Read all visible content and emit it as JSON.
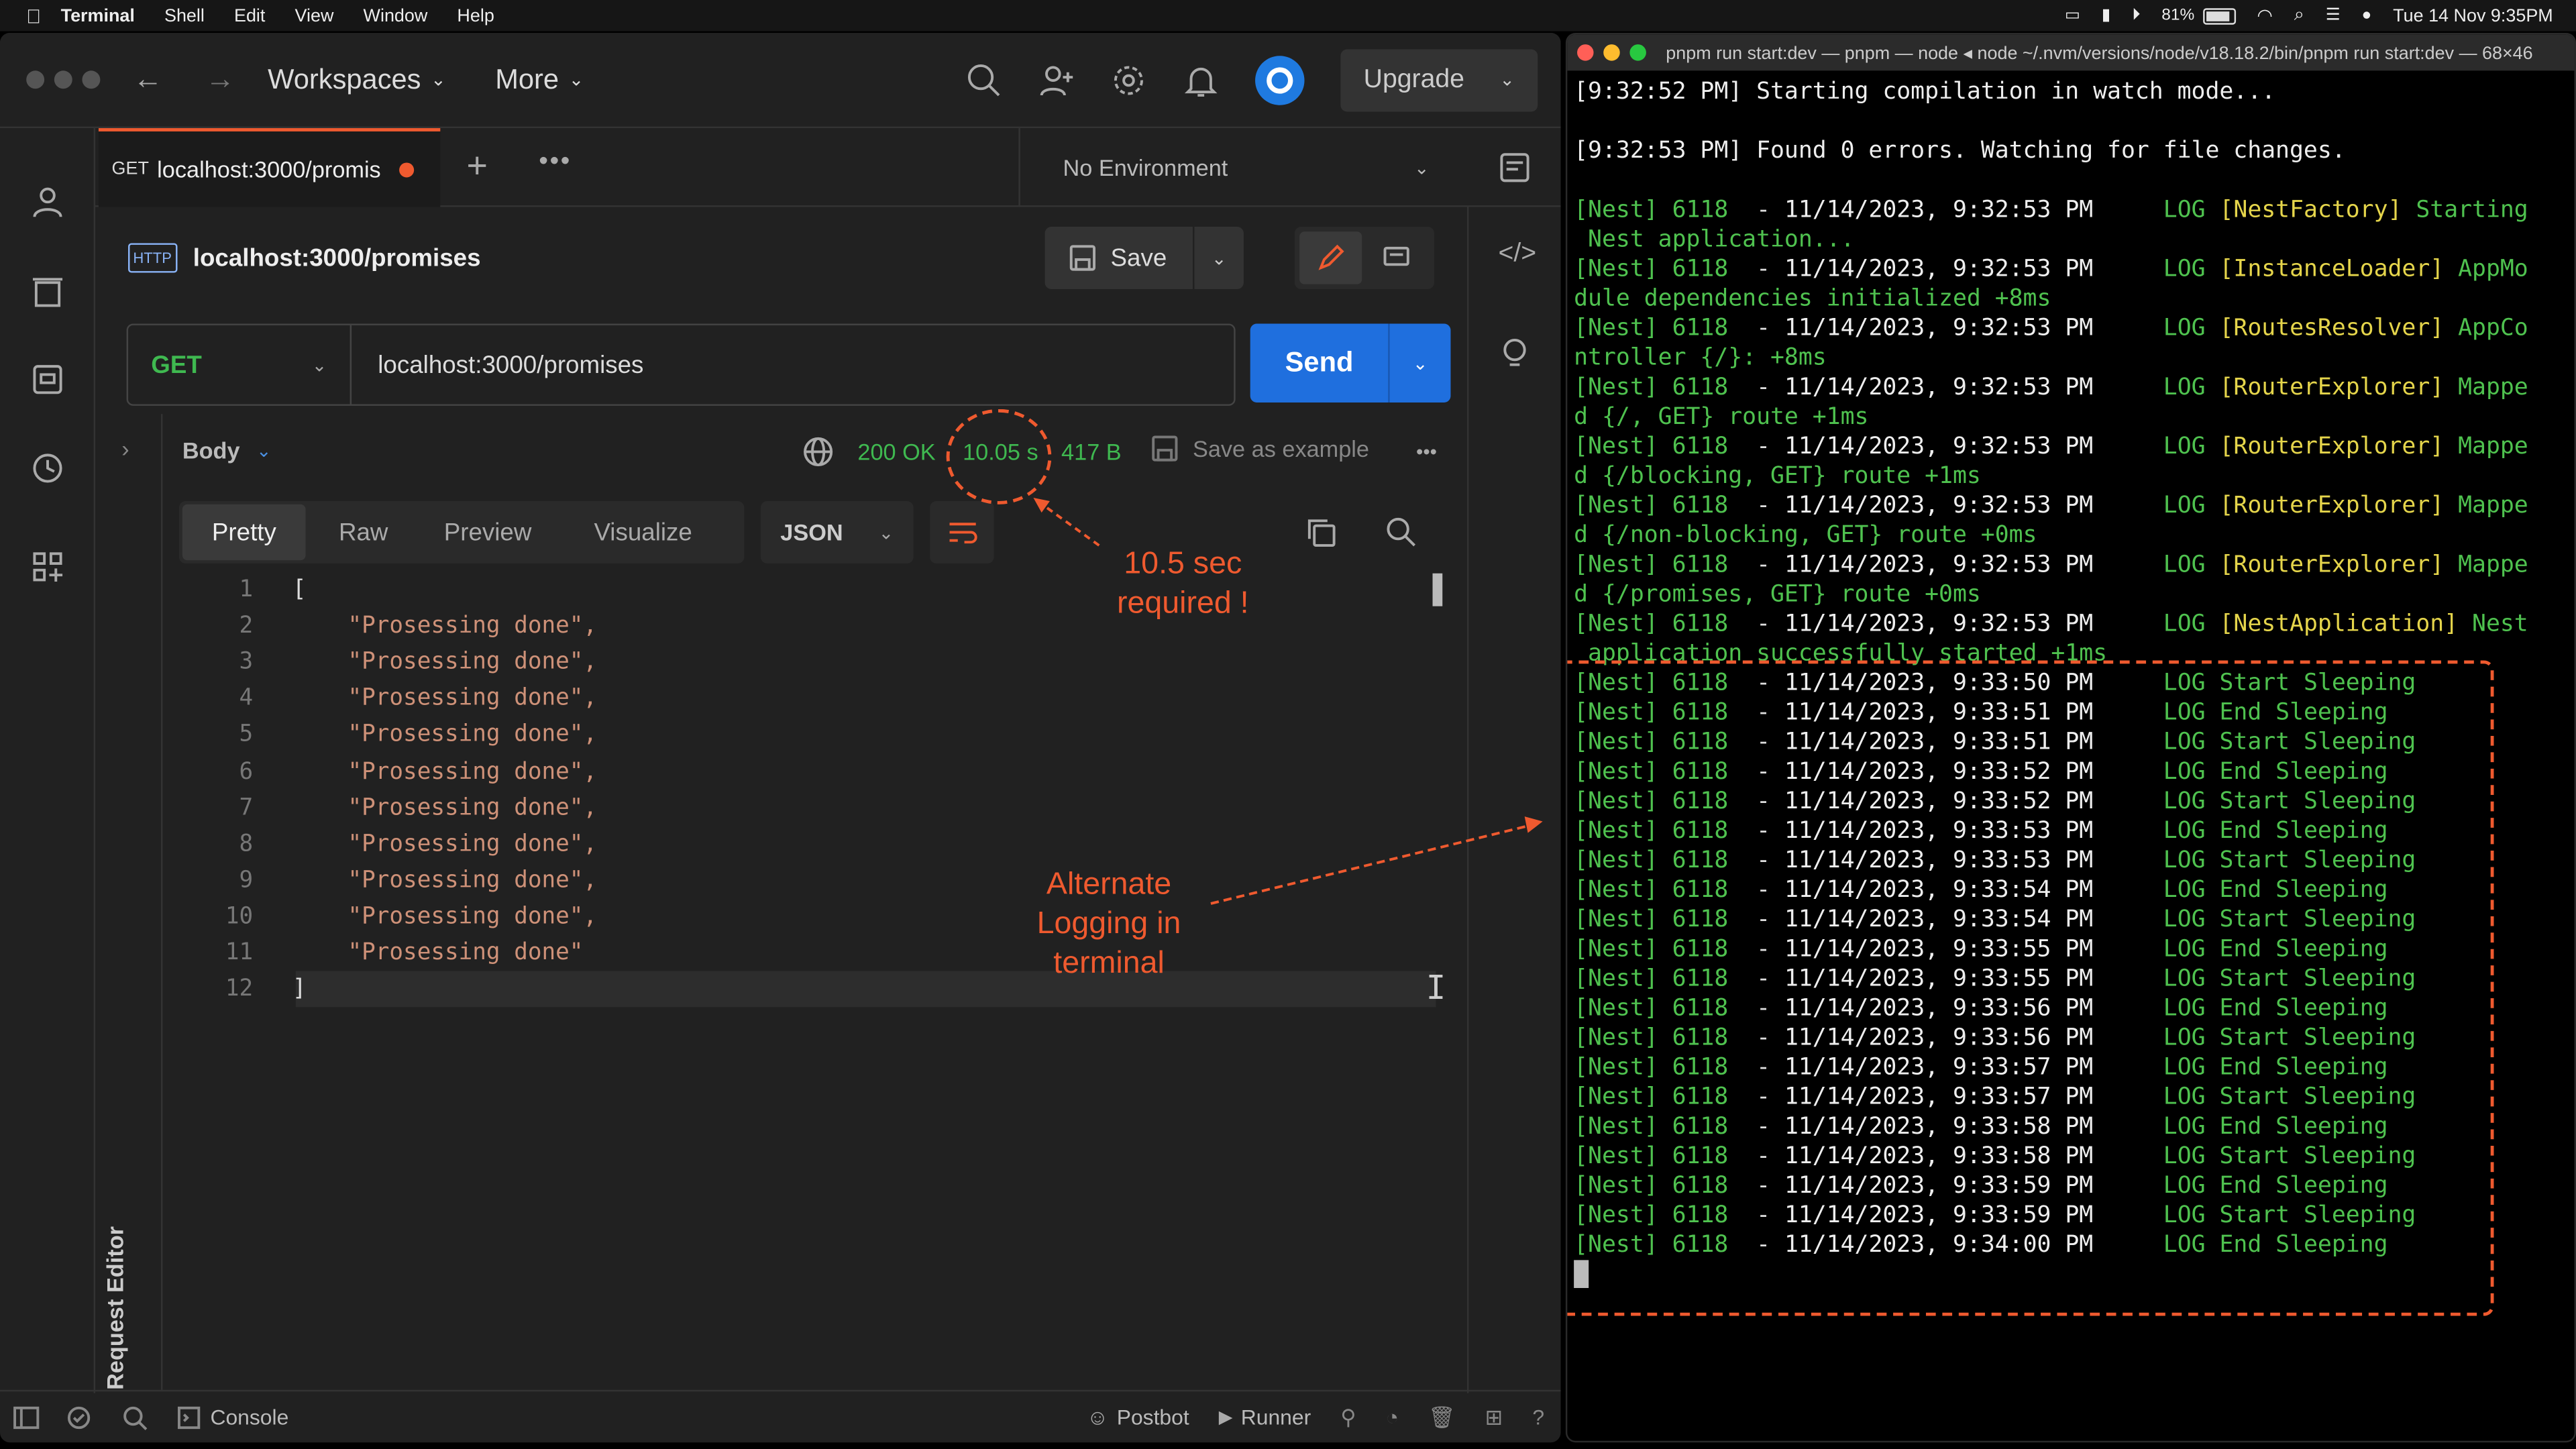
{
  "menubar": {
    "app": "Terminal",
    "items": [
      "Shell",
      "Edit",
      "View",
      "Window",
      "Help"
    ],
    "battery": "81%",
    "clock": "Tue 14 Nov  9:35PM"
  },
  "postman": {
    "workspaces_label": "Workspaces",
    "more_label": "More",
    "upgrade_label": "Upgrade",
    "tab": {
      "method": "GET",
      "title": "localhost:3000/promis"
    },
    "environment": "No Environment",
    "request": {
      "badge": "HTTP",
      "name": "localhost:3000/promises",
      "save_label": "Save",
      "method": "GET",
      "url": "localhost:3000/promises",
      "send_label": "Send"
    },
    "response": {
      "body_label": "Body",
      "status": "200 OK",
      "time": "10.05 s",
      "size": "417 B",
      "save_example": "Save as example",
      "views": [
        "Pretty",
        "Raw",
        "Preview",
        "Visualize"
      ],
      "active_view": "Pretty",
      "format": "JSON",
      "lines": [
        {
          "n": "1",
          "text": "["
        },
        {
          "n": "2",
          "text": "    \"Prosessing done\","
        },
        {
          "n": "3",
          "text": "    \"Prosessing done\","
        },
        {
          "n": "4",
          "text": "    \"Prosessing done\","
        },
        {
          "n": "5",
          "text": "    \"Prosessing done\","
        },
        {
          "n": "6",
          "text": "    \"Prosessing done\","
        },
        {
          "n": "7",
          "text": "    \"Prosessing done\","
        },
        {
          "n": "8",
          "text": "    \"Prosessing done\","
        },
        {
          "n": "9",
          "text": "    \"Prosessing done\","
        },
        {
          "n": "10",
          "text": "    \"Prosessing done\","
        },
        {
          "n": "11",
          "text": "    \"Prosessing done\""
        },
        {
          "n": "12",
          "text": "]"
        }
      ]
    },
    "side_label": "Request Editor",
    "statusbar": {
      "console": "Console",
      "postbot": "Postbot",
      "runner": "Runner"
    }
  },
  "annotations": {
    "time_note": [
      "10.5 sec",
      "required !"
    ],
    "log_note": [
      "Alternate",
      "Logging in",
      "terminal"
    ],
    "accent": "#ef5a2f"
  },
  "terminal": {
    "title": "pnpm run start:dev — pnpm — node ◂ node ~/.nvm/versions/node/v18.18.2/bin/pnpm run start:dev — 68×46",
    "lines": [
      {
        "t": "[9:32:52 PM] Starting compilation in watch mode...",
        "c": "tw"
      },
      {
        "t": "",
        "c": "tw"
      },
      {
        "t": "[9:32:53 PM] Found 0 errors. Watching for file changes.",
        "c": "tw"
      },
      {
        "t": "",
        "c": "tw"
      },
      {
        "t": "[Nest] 6118  - 11/14/2023, 9:32:53 PM     LOG [NestFactory] Starting",
        "c": "nest",
        "tag": "[NestFactory]",
        "msg": "Starting",
        "time": "11/14/2023, 9:32:53 PM"
      },
      {
        "t": " Nest application...",
        "c": "tg"
      },
      {
        "t": "[Nest] 6118  - 11/14/2023, 9:32:53 PM     LOG [InstanceLoader] AppMo",
        "c": "nest",
        "tag": "[InstanceLoader]",
        "msg": "AppMo",
        "time": "11/14/2023, 9:32:53 PM"
      },
      {
        "t": "dule dependencies initialized +8ms",
        "c": "tg"
      },
      {
        "t": "[Nest] 6118  - 11/14/2023, 9:32:53 PM     LOG [RoutesResolver] AppCo",
        "c": "nest",
        "tag": "[RoutesResolver]",
        "msg": "AppCo",
        "time": "11/14/2023, 9:32:53 PM"
      },
      {
        "t": "ntroller {/}: +8ms",
        "c": "tg"
      },
      {
        "t": "[Nest] 6118  - 11/14/2023, 9:32:53 PM     LOG [RouterExplorer] Mappe",
        "c": "nest",
        "tag": "[RouterExplorer]",
        "msg": "Mappe",
        "time": "11/14/2023, 9:32:53 PM"
      },
      {
        "t": "d {/, GET} route +1ms",
        "c": "tg"
      },
      {
        "t": "[Nest] 6118  - 11/14/2023, 9:32:53 PM     LOG [RouterExplorer] Mappe",
        "c": "nest",
        "tag": "[RouterExplorer]",
        "msg": "Mappe",
        "time": "11/14/2023, 9:32:53 PM"
      },
      {
        "t": "d {/blocking, GET} route +1ms",
        "c": "tg"
      },
      {
        "t": "[Nest] 6118  - 11/14/2023, 9:32:53 PM     LOG [RouterExplorer] Mappe",
        "c": "nest",
        "tag": "[RouterExplorer]",
        "msg": "Mappe",
        "time": "11/14/2023, 9:32:53 PM"
      },
      {
        "t": "d {/non-blocking, GET} route +0ms",
        "c": "tg"
      },
      {
        "t": "[Nest] 6118  - 11/14/2023, 9:32:53 PM     LOG [RouterExplorer] Mappe",
        "c": "nest",
        "tag": "[RouterExplorer]",
        "msg": "Mappe",
        "time": "11/14/2023, 9:32:53 PM"
      },
      {
        "t": "d {/promises, GET} route +0ms",
        "c": "tg"
      },
      {
        "t": "[Nest] 6118  - 11/14/2023, 9:32:53 PM     LOG [NestApplication] Nest",
        "c": "nest",
        "tag": "[NestApplication]",
        "msg": "Nest",
        "time": "11/14/2023, 9:32:53 PM"
      },
      {
        "t": " application successfully started +1ms",
        "c": "tg"
      },
      {
        "t": "",
        "c": "sleep",
        "msg": "Start Sleeping",
        "time": "11/14/2023, 9:33:50 PM"
      },
      {
        "t": "",
        "c": "sleep",
        "msg": "End Sleeping",
        "time": "11/14/2023, 9:33:51 PM"
      },
      {
        "t": "",
        "c": "sleep",
        "msg": "Start Sleeping",
        "time": "11/14/2023, 9:33:51 PM"
      },
      {
        "t": "",
        "c": "sleep",
        "msg": "End Sleeping",
        "time": "11/14/2023, 9:33:52 PM"
      },
      {
        "t": "",
        "c": "sleep",
        "msg": "Start Sleeping",
        "time": "11/14/2023, 9:33:52 PM"
      },
      {
        "t": "",
        "c": "sleep",
        "msg": "End Sleeping",
        "time": "11/14/2023, 9:33:53 PM"
      },
      {
        "t": "",
        "c": "sleep",
        "msg": "Start Sleeping",
        "time": "11/14/2023, 9:33:53 PM"
      },
      {
        "t": "",
        "c": "sleep",
        "msg": "End Sleeping",
        "time": "11/14/2023, 9:33:54 PM"
      },
      {
        "t": "",
        "c": "sleep",
        "msg": "Start Sleeping",
        "time": "11/14/2023, 9:33:54 PM"
      },
      {
        "t": "",
        "c": "sleep",
        "msg": "End Sleeping",
        "time": "11/14/2023, 9:33:55 PM"
      },
      {
        "t": "",
        "c": "sleep",
        "msg": "Start Sleeping",
        "time": "11/14/2023, 9:33:55 PM"
      },
      {
        "t": "",
        "c": "sleep",
        "msg": "End Sleeping",
        "time": "11/14/2023, 9:33:56 PM"
      },
      {
        "t": "",
        "c": "sleep",
        "msg": "Start Sleeping",
        "time": "11/14/2023, 9:33:56 PM"
      },
      {
        "t": "",
        "c": "sleep",
        "msg": "End Sleeping",
        "time": "11/14/2023, 9:33:57 PM"
      },
      {
        "t": "",
        "c": "sleep",
        "msg": "Start Sleeping",
        "time": "11/14/2023, 9:33:57 PM"
      },
      {
        "t": "",
        "c": "sleep",
        "msg": "End Sleeping",
        "time": "11/14/2023, 9:33:58 PM"
      },
      {
        "t": "",
        "c": "sleep",
        "msg": "Start Sleeping",
        "time": "11/14/2023, 9:33:58 PM"
      },
      {
        "t": "",
        "c": "sleep",
        "msg": "End Sleeping",
        "time": "11/14/2023, 9:33:59 PM"
      },
      {
        "t": "",
        "c": "sleep",
        "msg": "Start Sleeping",
        "time": "11/14/2023, 9:33:59 PM"
      },
      {
        "t": "",
        "c": "sleep",
        "msg": "End Sleeping",
        "time": "11/14/2023, 9:34:00 PM"
      }
    ],
    "nest_prefix": "[Nest] 6118",
    "log_word": "LOG"
  }
}
